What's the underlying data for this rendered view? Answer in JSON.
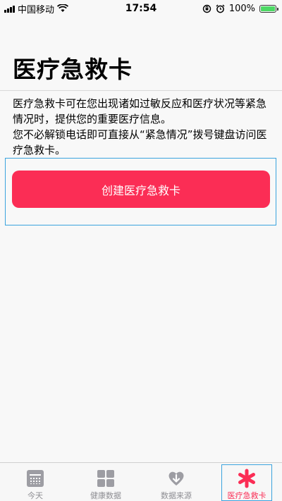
{
  "status_bar": {
    "carrier": "中国移动",
    "time": "17:54",
    "battery_percent": "100%",
    "battery_color": "#4cd964"
  },
  "page": {
    "title": "医疗急救卡",
    "description_1": "医疗急救卡可在您出现诸如过敏反应和医疗状况等紧急情况时，提供您的重要医疗信息。",
    "description_2": "您不必解锁电话即可直接从“紧急情况”拨号键盘访问医疗急救卡。",
    "create_button": "创建医疗急救卡",
    "accent_color": "#fb2d55"
  },
  "tabbar": {
    "tabs": [
      {
        "label": "今天",
        "icon": "calendar-icon",
        "active": false
      },
      {
        "label": "健康数据",
        "icon": "grid-icon",
        "active": false
      },
      {
        "label": "数据来源",
        "icon": "heart-download-icon",
        "active": false
      },
      {
        "label": "医疗急救卡",
        "icon": "medical-asterisk-icon",
        "active": true
      }
    ]
  }
}
